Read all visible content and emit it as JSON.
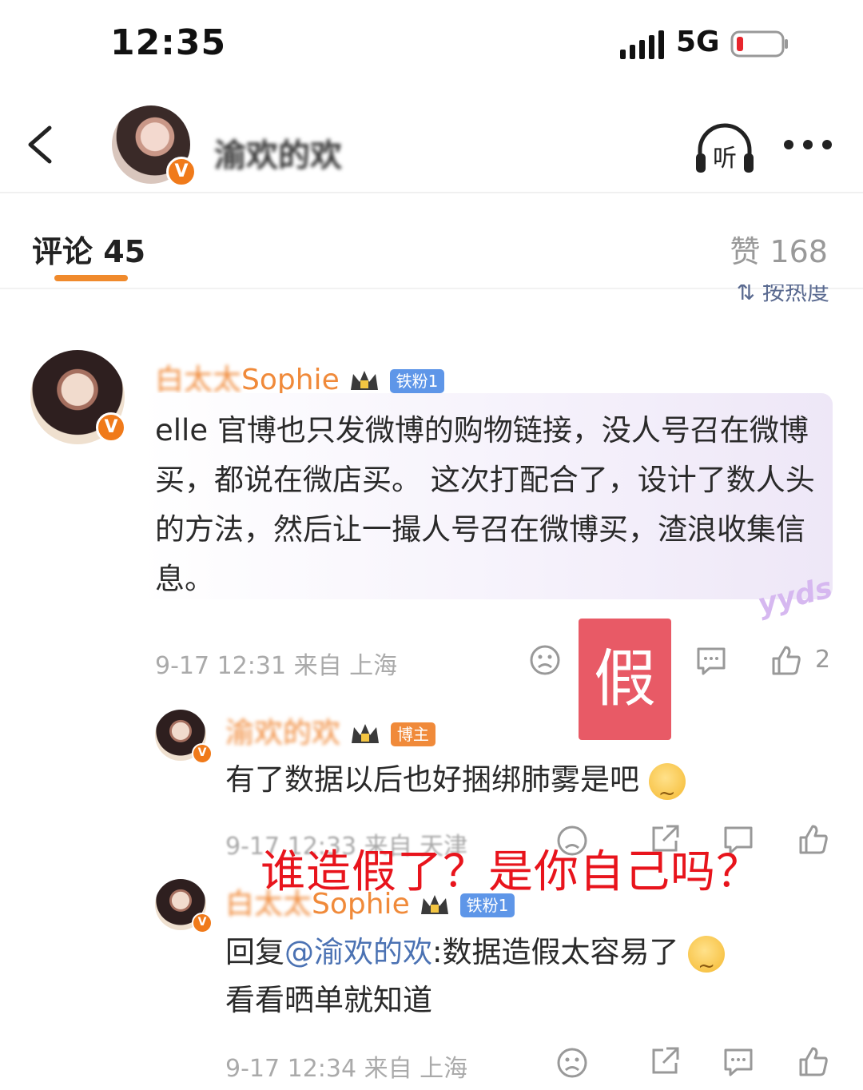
{
  "status_bar": {
    "time": "12:35",
    "network": "5G"
  },
  "header": {
    "blog_name": "渝欢的欢",
    "vip_badge": "V",
    "listen_label": "听"
  },
  "tabs": {
    "comment_label": "评论 45",
    "like_label": "赞 168",
    "sort_label": "按热度"
  },
  "main_comment": {
    "username_blur": "白太太",
    "username_tail": "Sophie",
    "fan_badge": "铁粉1",
    "text": "elle 官博也只发微博的购物链接，没人号召在微博买，都说在微店买。 这次打配合了，设计了数人头的方法，然后让一撮人号召在微博买，渣浪收集信息。",
    "sticker": "yyds",
    "meta": "9-17 12:31 来自 上海",
    "like_count": "2"
  },
  "fake_stamp": "假",
  "reply_1": {
    "username": "渝欢的欢",
    "badge": "博主",
    "text": "有了数据以后也好捆绑肺雾是吧",
    "meta": "9-17 12:33 来自 天津"
  },
  "annotation": "谁造假了？是你自己吗？",
  "reply_2": {
    "username_blur": "白太太",
    "username_tail": "Sophie",
    "fan_badge": "铁粉1",
    "reply_prefix": "回复",
    "mention": "@渝欢的欢",
    "text_line1": ":数据造假太容易了",
    "text_line2": "看看晒单就知道",
    "meta": "9-17 12:34 来自 上海"
  },
  "colors": {
    "accent": "#f08a2c",
    "username": "#f08a3a",
    "fan_badge": "#5e96e8",
    "stamp": "#e85a66",
    "annotation": "#e8141c",
    "mention": "#4b72b3"
  },
  "icons": [
    "back-icon",
    "listen-icon",
    "more-icon",
    "crown-icon",
    "dislike-face-icon",
    "comment-icon",
    "share-icon",
    "thumb-up-icon",
    "smirk-emoji-icon"
  ]
}
